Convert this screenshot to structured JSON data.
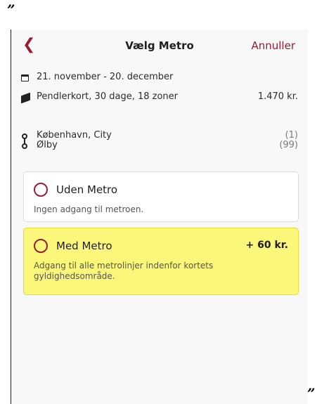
{
  "quotes": {
    "open": "”",
    "close": "”"
  },
  "header": {
    "back_icon": "chevron-left-icon",
    "title": "Vælg Metro",
    "cancel_label": "Annuller"
  },
  "summary": {
    "period": "21. november - 20. december",
    "product": "Pendlerkort, 30 dage, 18 zoner",
    "price": "1.470 kr."
  },
  "route": {
    "from_name": "København, City",
    "from_zone": "(1)",
    "to_name": "Ølby",
    "to_zone": "(99)"
  },
  "options": [
    {
      "title": "Uden Metro",
      "description": "Ingen adgang til metroen.",
      "price": "",
      "selected": false
    },
    {
      "title": "Med Metro",
      "description": "Adgang til alle metrolinjer indenfor kortets gyldighedsområde.",
      "price": "+ 60 kr.",
      "highlighted": true
    }
  ],
  "colors": {
    "accent": "#9b1b30",
    "highlight": "#fbf77a"
  }
}
